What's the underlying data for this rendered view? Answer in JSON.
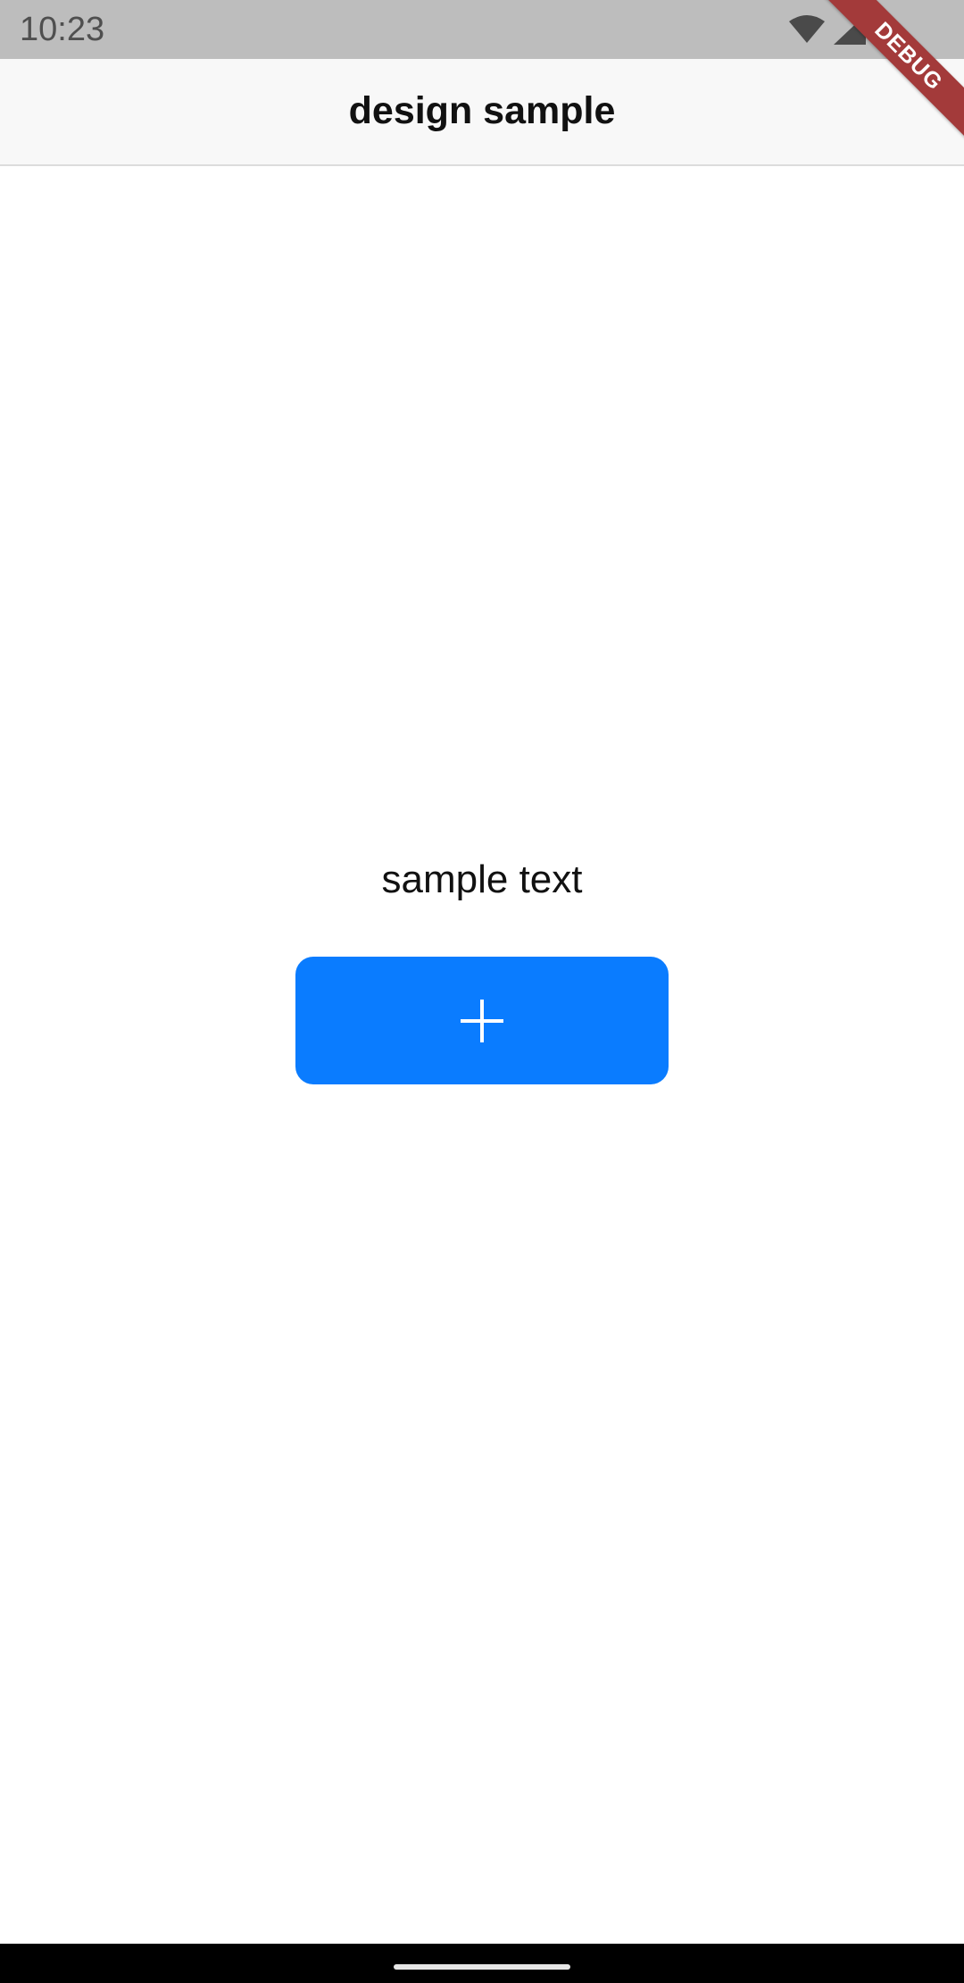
{
  "status_bar": {
    "time": "10:23",
    "icons": [
      "wifi-icon",
      "signal-icon",
      "battery-icon"
    ]
  },
  "app_bar": {
    "title": "design sample"
  },
  "debug_banner": {
    "label": "DEBUG"
  },
  "content": {
    "sample_text": "sample text",
    "add_button_icon": "plus-icon"
  },
  "colors": {
    "accent": "#0a7cff",
    "status_bar": "#bdbdbd",
    "app_bar": "#f8f8f8",
    "debug_banner": "#a33a3a",
    "nav_bar": "#000000"
  }
}
